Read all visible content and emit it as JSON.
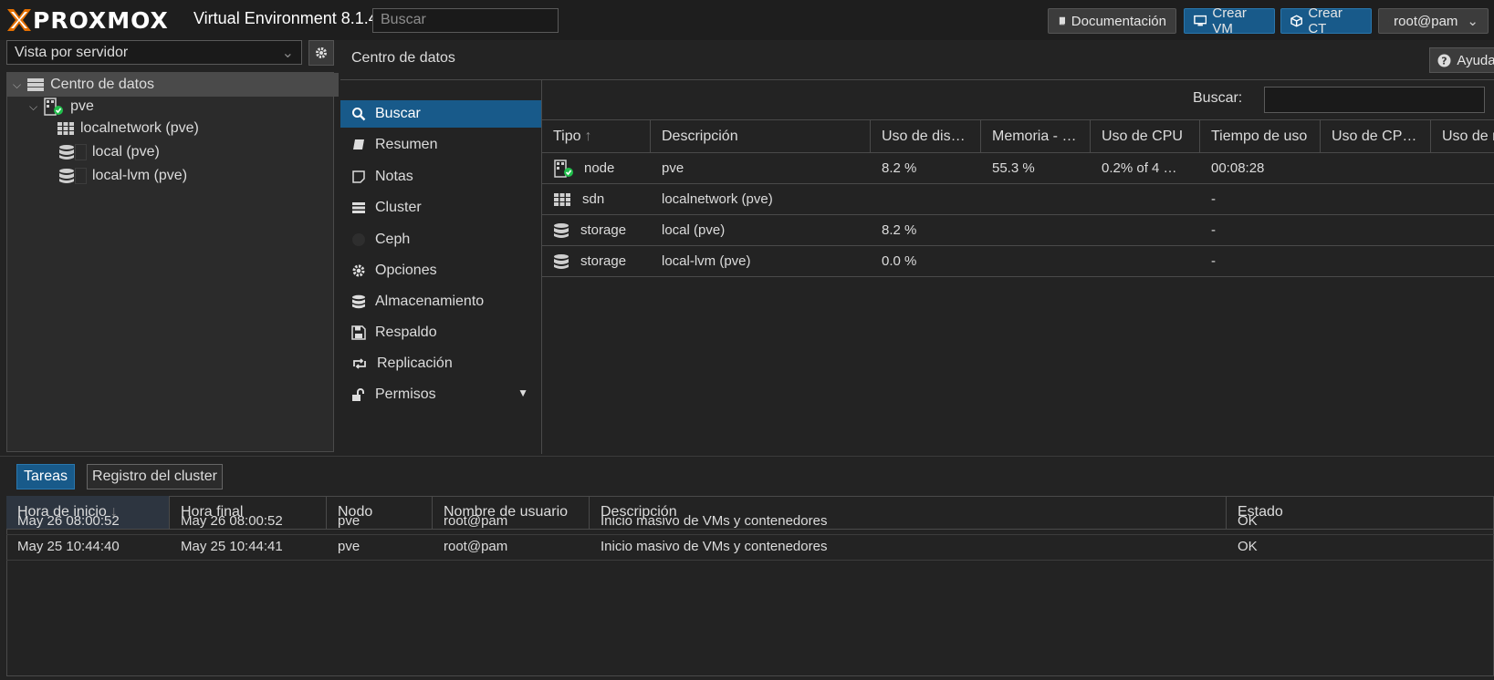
{
  "header": {
    "logo_text": "PROXMOX",
    "version": "Virtual Environment 8.1.4",
    "search_placeholder": "Buscar",
    "docs_label": "Documentación",
    "create_vm_label": "Crear VM",
    "create_ct_label": "Crear CT",
    "user_label": "root@pam"
  },
  "sidebar": {
    "view_selector": "Vista por servidor",
    "tree": {
      "root": "Centro de datos",
      "node": "pve",
      "children": [
        "localnetwork (pve)",
        "local (pve)",
        "local-lvm (pve)"
      ]
    }
  },
  "content": {
    "title": "Centro de datos",
    "help_label": "Ayuda",
    "nav": [
      {
        "label": "Buscar",
        "icon": "search-icon"
      },
      {
        "label": "Resumen",
        "icon": "book-icon"
      },
      {
        "label": "Notas",
        "icon": "note-icon"
      },
      {
        "label": "Cluster",
        "icon": "server-icon"
      },
      {
        "label": "Ceph",
        "icon": "ceph-icon"
      },
      {
        "label": "Opciones",
        "icon": "gear-icon"
      },
      {
        "label": "Almacenamiento",
        "icon": "database-icon"
      },
      {
        "label": "Respaldo",
        "icon": "floppy-icon"
      },
      {
        "label": "Replicación",
        "icon": "retweet-icon"
      },
      {
        "label": "Permisos",
        "icon": "unlock-icon"
      }
    ],
    "grid": {
      "search_label": "Buscar:",
      "columns": [
        "Tipo",
        "Descripción",
        "Uso de dis…",
        "Memoria - …",
        "Uso de CPU",
        "Tiempo de uso",
        "Uso de CP…",
        "Uso de r"
      ],
      "rows": [
        {
          "type": "node",
          "icon": "node-online-icon",
          "desc": "pve",
          "disk": "8.2 %",
          "mem": "55.3 %",
          "cpu": "0.2% of 4 …",
          "uptime": "00:08:28"
        },
        {
          "type": "sdn",
          "icon": "grid-icon",
          "desc": "localnetwork (pve)",
          "disk": "",
          "mem": "",
          "cpu": "",
          "uptime": "-"
        },
        {
          "type": "storage",
          "icon": "database-icon",
          "desc": "local (pve)",
          "disk": "8.2 %",
          "mem": "",
          "cpu": "",
          "uptime": "-"
        },
        {
          "type": "storage",
          "icon": "database-icon",
          "desc": "local-lvm (pve)",
          "disk": "0.0 %",
          "mem": "",
          "cpu": "",
          "uptime": "-"
        }
      ]
    }
  },
  "bottom": {
    "tabs": [
      "Tareas",
      "Registro del cluster"
    ],
    "columns": [
      "Hora de inicio",
      "Hora final",
      "Nodo",
      "Nombre de usuario",
      "Descripción",
      "Estado"
    ],
    "rows": [
      {
        "start": "May 26 08:00:52",
        "end": "May 26 08:00:52",
        "node": "pve",
        "user": "root@pam",
        "desc": "Inicio masivo de VMs y contenedores",
        "status": "OK"
      },
      {
        "start": "May 25 10:44:40",
        "end": "May 25 10:44:41",
        "node": "pve",
        "user": "root@pam",
        "desc": "Inicio masivo de VMs y contenedores",
        "status": "OK"
      }
    ]
  },
  "colors": {
    "accent": "#185a8a",
    "logo_x": "#e57000",
    "status_ok": "#21bf4b"
  }
}
